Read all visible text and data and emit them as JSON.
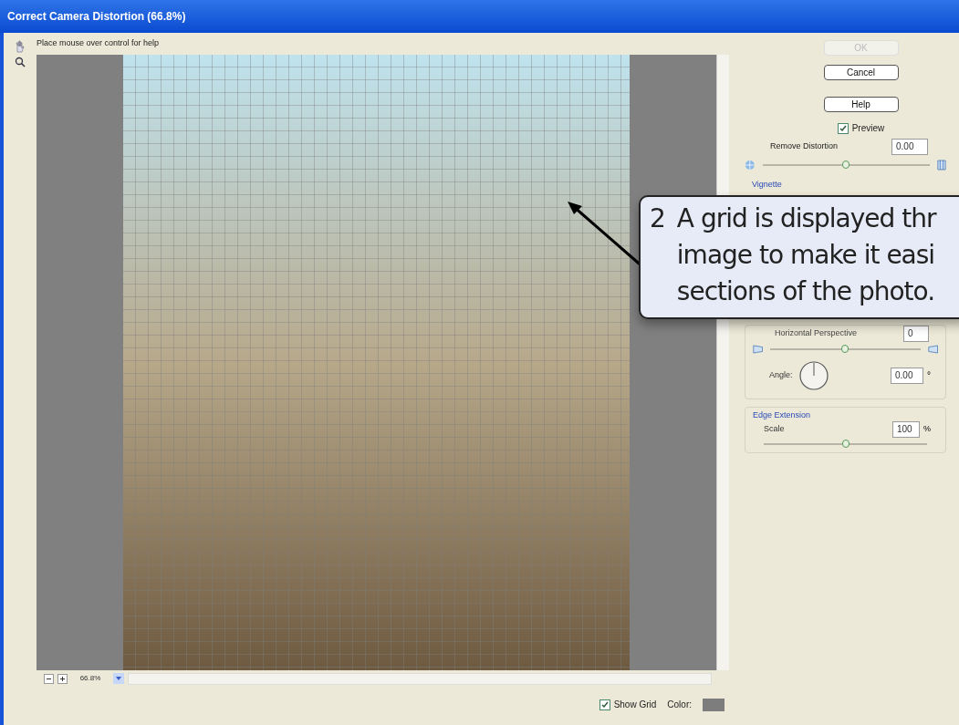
{
  "window": {
    "title": "Correct Camera Distortion (66.8%)"
  },
  "help_text": "Place mouse over control for help",
  "zoom": {
    "value": "66.8%"
  },
  "buttons": [
    {
      "label": "OK",
      "disabled": true
    },
    {
      "label": "Cancel",
      "disabled": false
    },
    {
      "label": "Help",
      "disabled": false
    }
  ],
  "preview": {
    "label": "Preview",
    "checked": true
  },
  "remove_distortion": {
    "label": "Remove Distortion",
    "value": "0.00",
    "level": 0.5
  },
  "vignette": {
    "label": "Vignette"
  },
  "horizontal_perspective": {
    "label": "Horizontal Perspective",
    "value": "0",
    "level": 0.5
  },
  "angle": {
    "label": "Angle:",
    "value": "0.00",
    "unit": "°"
  },
  "edge_extension": {
    "label": "Edge Extension",
    "scale_label": "Scale",
    "value": "100",
    "unit": "%",
    "level": 0.5
  },
  "show_grid": {
    "label": "Show Grid",
    "checked": true
  },
  "grid_color": {
    "label": "Color:",
    "color": "#7d7d7d"
  },
  "callout": {
    "number": "2",
    "lines": [
      "A grid is displayed thr",
      "image to make it easi",
      "sections of the photo."
    ]
  }
}
